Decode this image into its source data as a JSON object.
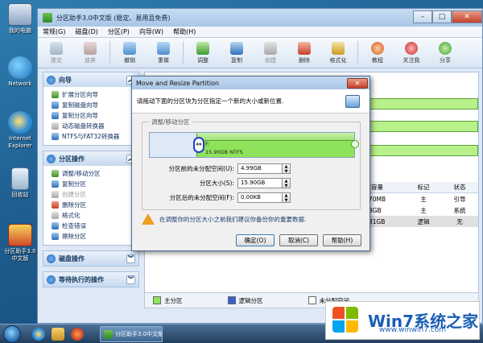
{
  "desktop": {
    "icons": [
      {
        "label": "我的电脑"
      },
      {
        "label": "Network"
      },
      {
        "label": "Internet Explorer"
      },
      {
        "label": "回收站"
      },
      {
        "label": "分区助手3.0中文版"
      }
    ]
  },
  "window": {
    "title": "分区助手3.0中文版 (稳定、易用且免费)",
    "controls": {
      "minimize": "–",
      "maximize": "□",
      "close": "✕"
    }
  },
  "menu": [
    "常规(G)",
    "磁盘(D)",
    "分区(P)",
    "向导(W)",
    "帮助(H)"
  ],
  "toolbar": {
    "buttons": [
      {
        "label": "提交",
        "enabled": false
      },
      {
        "label": "放弃",
        "enabled": false
      },
      {
        "label": "撤销",
        "enabled": true
      },
      {
        "label": "重做",
        "enabled": true
      },
      {
        "label": "调整",
        "enabled": true
      },
      {
        "label": "复制",
        "enabled": true
      },
      {
        "label": "创建",
        "enabled": false
      },
      {
        "label": "删除",
        "enabled": true
      },
      {
        "label": "格式化",
        "enabled": true
      },
      {
        "label": "教程",
        "enabled": true
      },
      {
        "label": "关注我",
        "enabled": true
      },
      {
        "label": "分享",
        "enabled": true
      }
    ]
  },
  "panels": {
    "wizard": {
      "title": "向导",
      "items": [
        "扩展分区向导",
        "复制磁盘向导",
        "复制分区向导",
        "动态磁盘转换器",
        "NTFS与FAT32转换器"
      ]
    },
    "partition_ops": {
      "title": "分区操作",
      "items": [
        "调整/移动分区",
        "复制分区",
        "创建分区",
        "删除分区",
        "格式化",
        "检查错误",
        "擦除分区"
      ],
      "disabled": [
        "创建分区"
      ]
    },
    "disk_ops": {
      "title": "磁盘操作"
    },
    "pending_ops": {
      "title": "等待执行的操作"
    }
  },
  "table": {
    "headers": [
      "使用容量",
      "标记",
      "状态"
    ],
    "rows": [
      {
        "used": "75.70MB",
        "flag": "主",
        "status": "引导"
      },
      {
        "used": "8.08GB",
        "flag": "主",
        "status": "系统"
      },
      {
        "used": "20.81GB",
        "flag": "逻辑",
        "status": "无"
      }
    ]
  },
  "legend": [
    {
      "label": "主分区",
      "color": "#8fe35a"
    },
    {
      "label": "逻辑分区",
      "color": "#3a5fd0"
    },
    {
      "label": "未分配空间",
      "color": "#ffffff"
    }
  ],
  "dialog": {
    "title": "Move and Resize Partition",
    "close": "✕",
    "instruction": "请拖动下面的分区块为分区指定一个新的大小或新位置.",
    "group_label": "调整/移动分区",
    "partition": {
      "name": "F:",
      "info": "15.90GB NTFS",
      "position": 0.23,
      "fraction": 0.77
    },
    "fields": [
      {
        "label": "分区前的未分配空间(U):",
        "value": "4.99GB"
      },
      {
        "label": "分区大小(S):",
        "value": "15.90GB"
      },
      {
        "label": "分区后的未分配空间(F):",
        "value": "0.00KB"
      }
    ],
    "warning": "在调整你的分区大小之前我们建议你备份你的重要数据.",
    "buttons": {
      "ok": "确定(O)",
      "cancel": "取消(C)",
      "help": "帮助(H)"
    }
  },
  "taskbar": {
    "task_label": "分区助手3.0中文版 (..."
  },
  "watermark": {
    "brand": "Win7系统之家",
    "site": "www.winwin7.com"
  }
}
